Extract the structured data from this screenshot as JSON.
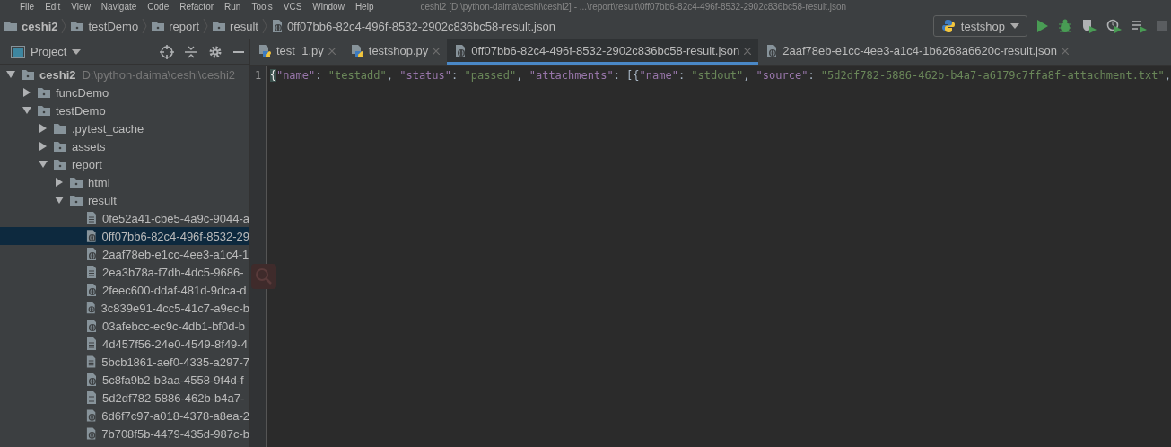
{
  "menu_bar": {
    "items": [
      "File",
      "Edit",
      "View",
      "Navigate",
      "Code",
      "Refactor",
      "Run",
      "Tools",
      "VCS",
      "Window",
      "Help"
    ],
    "title": "ceshi2 [D:\\python-daima\\ceshi\\ceshi2] - ...\\report\\result\\0ff07bb6-82c4-496f-8532-2902c836bc58-result.json"
  },
  "breadcrumbs": [
    {
      "label": "ceshi2",
      "kind": "project"
    },
    {
      "label": "testDemo",
      "kind": "folder"
    },
    {
      "label": "report",
      "kind": "folder"
    },
    {
      "label": "result",
      "kind": "folder"
    },
    {
      "label": "0ff07bb6-82c4-496f-8532-2902c836bc58-result.json",
      "kind": "json"
    }
  ],
  "run_config": {
    "label": "testshop"
  },
  "project_panel": {
    "title": "Project",
    "tree": [
      {
        "label": "ceshi2",
        "path": "D:\\python-daima\\ceshi\\ceshi2",
        "kind": "folder",
        "expanded": true,
        "selected": false,
        "children": [
          {
            "label": "funcDemo",
            "kind": "folder",
            "expanded": false,
            "selected": false
          },
          {
            "label": "testDemo",
            "kind": "folder",
            "expanded": true,
            "selected": false,
            "children": [
              {
                "label": ".pytest_cache",
                "kind": "plainfolder",
                "expanded": false,
                "selected": false
              },
              {
                "label": "assets",
                "kind": "folder",
                "expanded": false,
                "selected": false
              },
              {
                "label": "report",
                "kind": "folder",
                "expanded": true,
                "selected": false,
                "children": [
                  {
                    "label": "html",
                    "kind": "folder",
                    "expanded": false,
                    "selected": false
                  },
                  {
                    "label": "result",
                    "kind": "folder",
                    "expanded": true,
                    "selected": false,
                    "children": [
                      {
                        "label": "0fe52a41-cbe5-4a9c-9044-a",
                        "kind": "text",
                        "selected": false
                      },
                      {
                        "label": "0ff07bb6-82c4-496f-8532-29",
                        "kind": "json",
                        "selected": true
                      },
                      {
                        "label": "2aaf78eb-e1cc-4ee3-a1c4-1",
                        "kind": "json",
                        "selected": false
                      },
                      {
                        "label": "2ea3b78a-f7db-4dc5-9686-",
                        "kind": "text",
                        "selected": false
                      },
                      {
                        "label": "2feec600-ddaf-481d-9dca-d",
                        "kind": "json",
                        "selected": false
                      },
                      {
                        "label": "3c839e91-4cc5-41c7-a9ec-b",
                        "kind": "json",
                        "selected": false
                      },
                      {
                        "label": "03afebcc-ec9c-4db1-bf0d-b",
                        "kind": "json",
                        "selected": false
                      },
                      {
                        "label": "4d457f56-24e0-4549-8f49-4",
                        "kind": "text",
                        "selected": false
                      },
                      {
                        "label": "5bcb1861-aef0-4335-a297-7",
                        "kind": "text",
                        "selected": false
                      },
                      {
                        "label": "5c8fa9b2-b3aa-4558-9f4d-f",
                        "kind": "json",
                        "selected": false
                      },
                      {
                        "label": "5d2df782-5886-462b-b4a7-",
                        "kind": "text",
                        "selected": false
                      },
                      {
                        "label": "6d6f7c97-a018-4378-a8ea-2",
                        "kind": "json",
                        "selected": false
                      },
                      {
                        "label": "7b708f5b-4479-435d-987c-b",
                        "kind": "json",
                        "selected": false
                      }
                    ]
                  }
                ]
              }
            ]
          }
        ]
      }
    ]
  },
  "editor_tabs": [
    {
      "label": "test_1.py",
      "kind": "python",
      "selected": false
    },
    {
      "label": "testshop.py",
      "kind": "python",
      "selected": false
    },
    {
      "label": "0ff07bb6-82c4-496f-8532-2902c836bc58-result.json",
      "kind": "json",
      "selected": true
    },
    {
      "label": "2aaf78eb-e1cc-4ee3-a1c4-1b6268a6620c-result.json",
      "kind": "json",
      "selected": false
    }
  ],
  "editor": {
    "lines": [
      {
        "number": "1",
        "tokens": [
          {
            "text": "{",
            "kind": "punct"
          },
          {
            "text": "\"name\"",
            "kind": "key"
          },
          {
            "text": ": ",
            "kind": "punct"
          },
          {
            "text": "\"testadd\"",
            "kind": "string"
          },
          {
            "text": ", ",
            "kind": "punct"
          },
          {
            "text": "\"status\"",
            "kind": "key"
          },
          {
            "text": ": ",
            "kind": "punct"
          },
          {
            "text": "\"passed\"",
            "kind": "string"
          },
          {
            "text": ", ",
            "kind": "punct"
          },
          {
            "text": "\"attachments\"",
            "kind": "key"
          },
          {
            "text": ": [{",
            "kind": "punct"
          },
          {
            "text": "\"name\"",
            "kind": "key"
          },
          {
            "text": ": ",
            "kind": "punct"
          },
          {
            "text": "\"stdout\"",
            "kind": "string"
          },
          {
            "text": ", ",
            "kind": "punct"
          },
          {
            "text": "\"source\"",
            "kind": "key"
          },
          {
            "text": ": ",
            "kind": "punct"
          },
          {
            "text": "\"5d2df782-5886-462b-b4a7-a6179c7ffa8f-attachment.txt\"",
            "kind": "string"
          },
          {
            "text": ",",
            "kind": "punct"
          }
        ]
      }
    ]
  }
}
